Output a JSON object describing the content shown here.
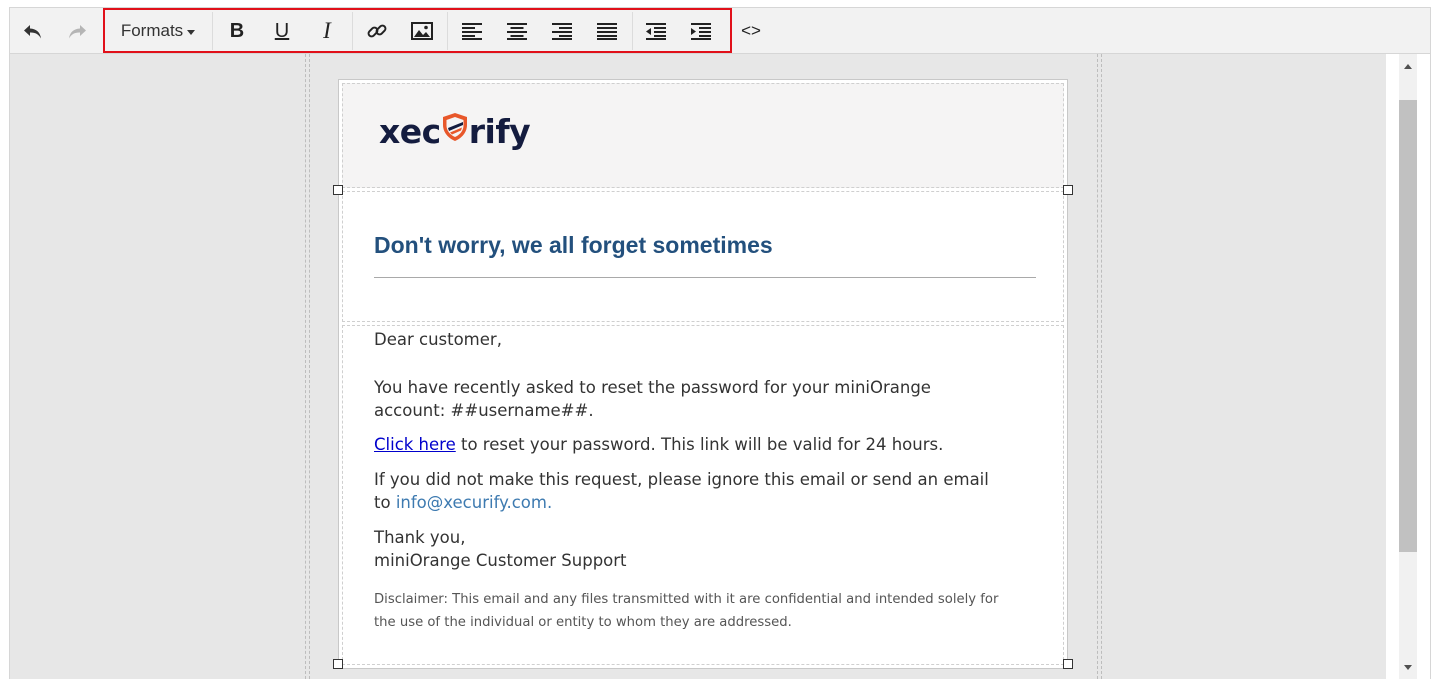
{
  "toolbar": {
    "formats_label": "Formats",
    "undo_icon": "undo-icon",
    "redo_icon": "redo-icon",
    "bold_label": "B",
    "underline_label": "U",
    "italic_label": "I",
    "code_label": "<>",
    "icons": [
      "link-icon",
      "image-icon",
      "align-left-icon",
      "align-center-icon",
      "align-right-icon",
      "align-justify-icon",
      "outdent-icon",
      "indent-icon"
    ],
    "highlight_color": "#e1101a"
  },
  "email": {
    "logo": {
      "part1": "xec",
      "part2": "rify",
      "shield_colors": [
        "#e8572a",
        "#141c3f"
      ]
    },
    "heading": "Don't worry, we all forget sometimes",
    "heading_color": "#23507d",
    "greeting": "Dear customer,",
    "para1_line1": "You have recently asked to reset the password for your miniOrange",
    "para1_line2": "account: ##username##.",
    "link_text": "Click here",
    "link_rest": " to reset your password. This link will be valid for 24 hours.",
    "para3_line1": "If you did not make this request, please ignore this email or send an email",
    "para3_to": "to ",
    "email_address": "info@xecurify.com.",
    "thanks": "Thank you,",
    "signature": "miniOrange Customer Support",
    "disclaimer_line1": "Disclaimer: This email and any files transmitted with it are confidential and intended solely for",
    "disclaimer_line2": "the use of the individual or entity to whom they are addressed."
  }
}
